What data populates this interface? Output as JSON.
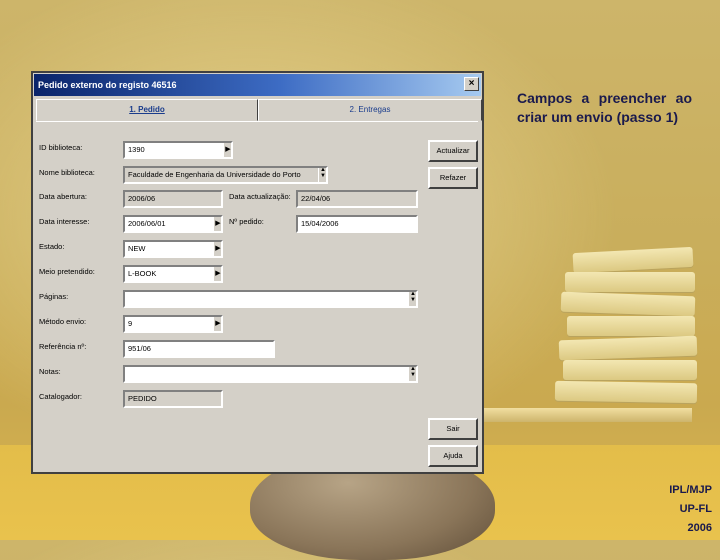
{
  "dialog": {
    "title": "Pedido externo do registo 46516",
    "close_glyph": "×",
    "tabs": [
      {
        "label": "1. Pedido"
      },
      {
        "label": "2. Entregas"
      }
    ],
    "fields": {
      "id_biblioteca": {
        "label": "ID biblioteca:",
        "value": "1390"
      },
      "nome_biblioteca": {
        "label": "Nome biblioteca:",
        "value": "Faculdade de Engenharia da Universidade do Porto"
      },
      "data_abertura": {
        "label": "Data abertura:",
        "value": "2006/06"
      },
      "data_actualizacao": {
        "label": "Data actualização:",
        "value": "22/04/06"
      },
      "data_interesse": {
        "label": "Data interesse:",
        "value": "2006/06/01"
      },
      "n_pedido": {
        "label": "Nº pedido:",
        "value": "15/04/2006"
      },
      "estado": {
        "label": "Estado:",
        "value": "NEW"
      },
      "meio_pretendido": {
        "label": "Meio pretendido:",
        "value": "L-BOOK"
      },
      "paginas": {
        "label": "Páginas:",
        "value": ""
      },
      "metodo_envio": {
        "label": "Método envio:",
        "value": "9"
      },
      "referencia": {
        "label": "Referência nº:",
        "value": "951/06"
      },
      "notas": {
        "label": "Notas:",
        "value": ""
      },
      "catalogador": {
        "label": "Catalogador:",
        "value": "PEDIDO"
      }
    },
    "buttons": {
      "actualizar": "Actualizar",
      "refazer": "Refazer",
      "sair": "Sair",
      "ajuda": "Ajuda"
    }
  },
  "slide": {
    "heading": "Campos a preencher ao criar um envio (passo 1)",
    "footer_line1": "IPL/MJP",
    "footer_line2": "UP-FL",
    "footer_line3": "2006"
  },
  "icons": {
    "dropdown": "triangle-right",
    "scroll": "scroll-arrows"
  }
}
